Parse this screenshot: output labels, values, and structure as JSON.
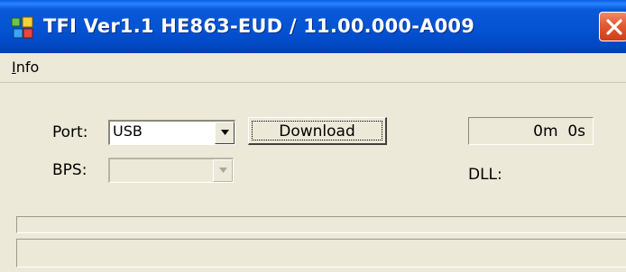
{
  "window": {
    "title": "TFI Ver1.1   HE863-EUD / 11.00.000-A009",
    "colors": {
      "titlebar": "#0453d3",
      "close": "#e25a33",
      "face": "#ece9d8"
    }
  },
  "menu": {
    "items": [
      {
        "label": "nfo",
        "accel": "I"
      }
    ]
  },
  "form": {
    "port_label": "Port:",
    "port_value": "USB",
    "bps_label": "BPS:",
    "bps_value": "",
    "download_label": "Download",
    "timer_value": "0m  0s",
    "dll_label": "DLL:"
  },
  "icons": [
    "app-icon",
    "close-icon",
    "dropdown-arrow-icon"
  ]
}
